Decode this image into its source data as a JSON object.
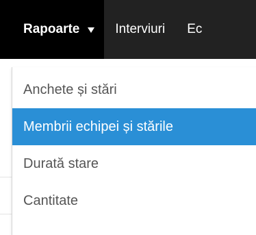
{
  "nav": {
    "items": [
      {
        "label": "Rapoarte",
        "active": true,
        "has_caret": true
      },
      {
        "label": "Interviuri",
        "active": false
      },
      {
        "label": "Ec",
        "active": false
      }
    ]
  },
  "dropdown": {
    "items": [
      {
        "label": "Anchete și stări",
        "selected": false
      },
      {
        "label": "Membrii echipei și stările",
        "selected": true
      },
      {
        "label": "Durată stare",
        "selected": false
      },
      {
        "label": "Cantitate",
        "selected": false
      }
    ]
  },
  "colors": {
    "topbar": "#222222",
    "active_nav": "#000000",
    "selected_item": "#2a8fd6",
    "menu_text": "#555555"
  }
}
